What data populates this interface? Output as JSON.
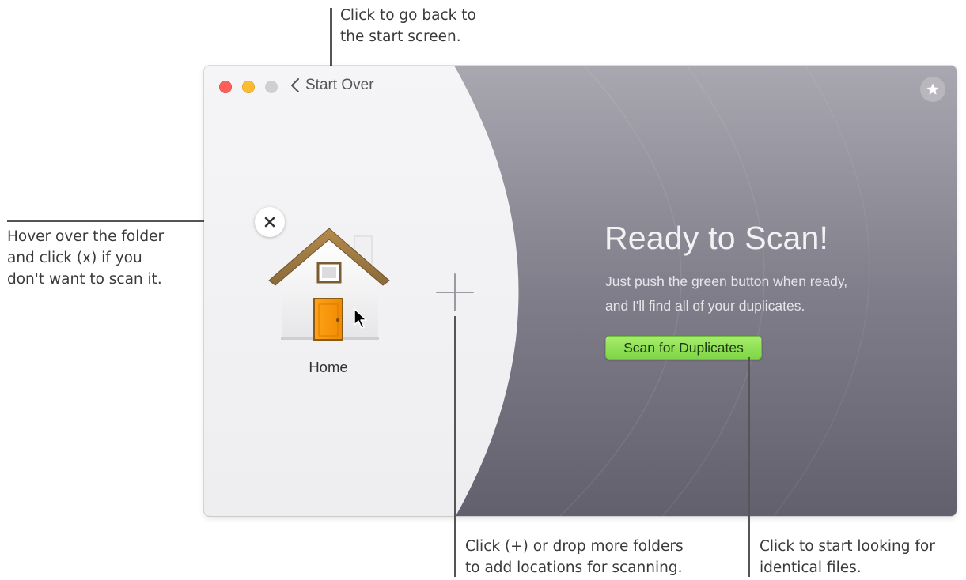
{
  "callouts": {
    "top": [
      "Click to go back to",
      "the start screen."
    ],
    "left": [
      "Hover over the folder",
      "and click (x) if you",
      "don't want to scan it."
    ],
    "bottom_middle": [
      "Click (+) or drop more folders",
      "to add locations for scanning."
    ],
    "bottom_right": [
      "Click to start looking for",
      "identical files."
    ]
  },
  "titlebar": {
    "back_label": "Start Over"
  },
  "folder": {
    "name": "Home",
    "icon": "home-folder-icon"
  },
  "main": {
    "title": "Ready to Scan!",
    "description": [
      "Just push the green button when ready,",
      "and I'll find all of your duplicates."
    ],
    "scan_button": "Scan for Duplicates"
  },
  "colors": {
    "close": "#ff5f57",
    "minimize": "#febc2e",
    "zoom_disabled": "#cfcfcf",
    "scan_button": "#8fe056",
    "right_panel": "#7d7b86",
    "left_panel": "#f2f2f4"
  }
}
